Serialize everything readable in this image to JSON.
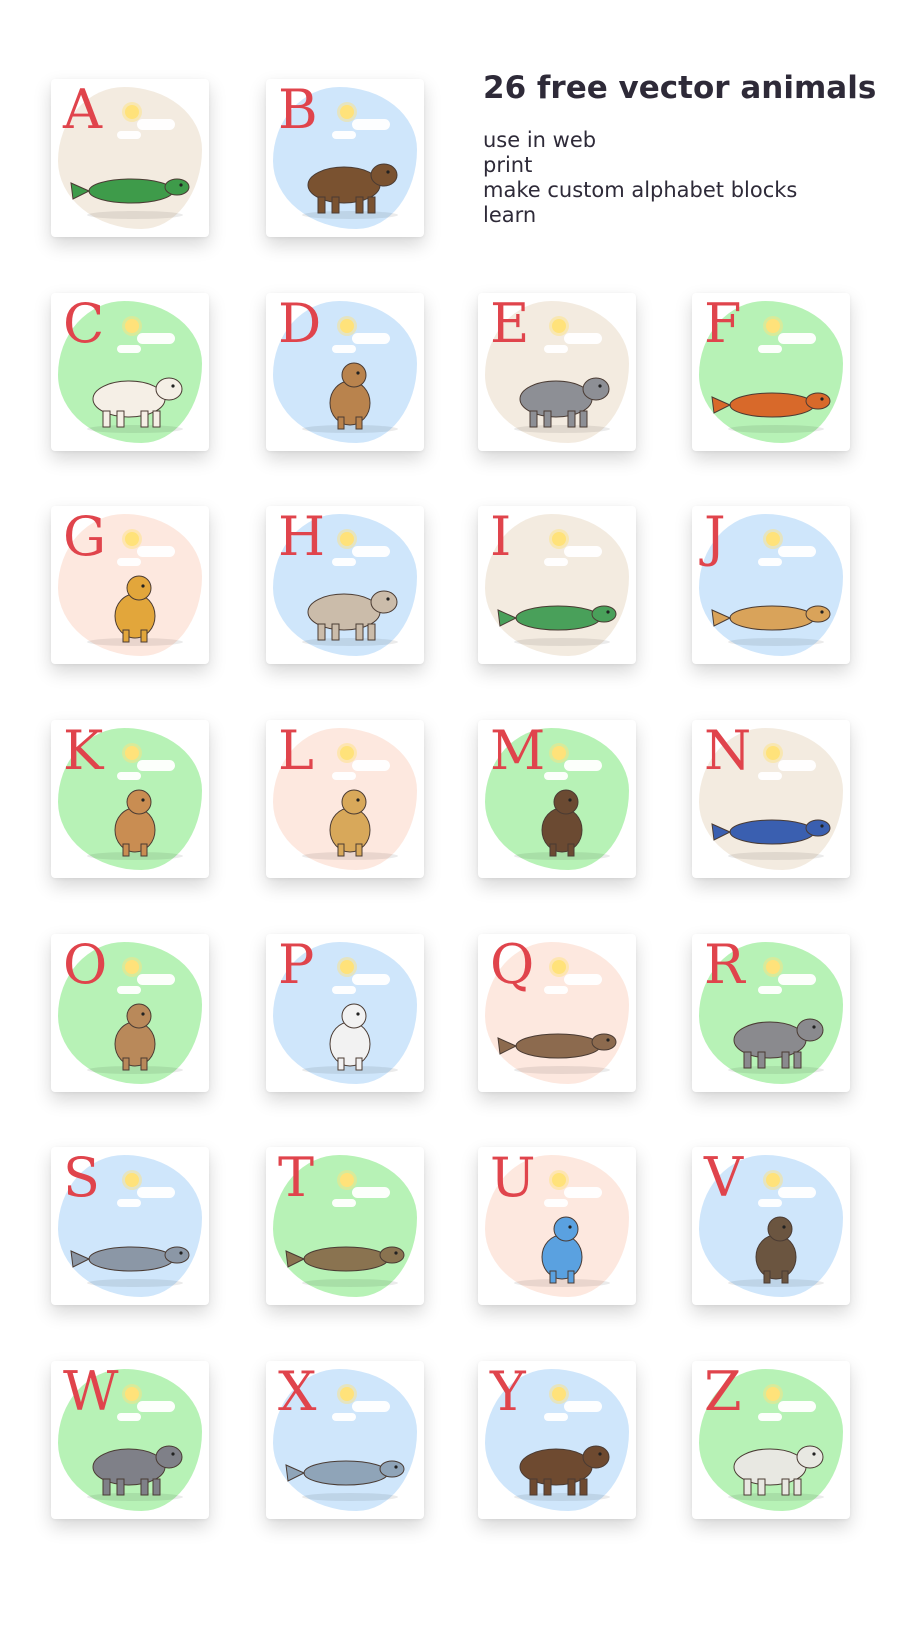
{
  "header": {
    "title": "26 free vector animals",
    "uses": [
      "use in web",
      "print",
      "make custom alphabet blocks",
      "learn"
    ]
  },
  "cards": [
    {
      "letter": "A",
      "animal": "alligator",
      "bg": "beige"
    },
    {
      "letter": "B",
      "animal": "bear",
      "bg": "blue"
    },
    {
      "letter": "C",
      "animal": "cow",
      "bg": "green"
    },
    {
      "letter": "D",
      "animal": "deer",
      "bg": "blue"
    },
    {
      "letter": "E",
      "animal": "elephant",
      "bg": "beige"
    },
    {
      "letter": "F",
      "animal": "fox",
      "bg": "green"
    },
    {
      "letter": "G",
      "animal": "giraffe",
      "bg": "pink"
    },
    {
      "letter": "H",
      "animal": "horse",
      "bg": "blue"
    },
    {
      "letter": "I",
      "animal": "iguana",
      "bg": "beige"
    },
    {
      "letter": "J",
      "animal": "jaguar",
      "bg": "blue"
    },
    {
      "letter": "K",
      "animal": "kangaroo",
      "bg": "green"
    },
    {
      "letter": "L",
      "animal": "lion",
      "bg": "pink"
    },
    {
      "letter": "M",
      "animal": "monkey",
      "bg": "green"
    },
    {
      "letter": "N",
      "animal": "narwhal",
      "bg": "beige"
    },
    {
      "letter": "O",
      "animal": "owl",
      "bg": "green"
    },
    {
      "letter": "P",
      "animal": "panda",
      "bg": "blue"
    },
    {
      "letter": "Q",
      "animal": "quail",
      "bg": "pink"
    },
    {
      "letter": "R",
      "animal": "raccoon",
      "bg": "green"
    },
    {
      "letter": "S",
      "animal": "shark",
      "bg": "blue"
    },
    {
      "letter": "T",
      "animal": "tortoise",
      "bg": "green"
    },
    {
      "letter": "U",
      "animal": "unicorn",
      "bg": "pink"
    },
    {
      "letter": "V",
      "animal": "vulture",
      "bg": "blue"
    },
    {
      "letter": "W",
      "animal": "wolf",
      "bg": "green"
    },
    {
      "letter": "X",
      "animal": "x-ray fish",
      "bg": "blue"
    },
    {
      "letter": "Y",
      "animal": "yak",
      "bg": "blue"
    },
    {
      "letter": "Z",
      "animal": "zebra",
      "bg": "green"
    }
  ],
  "colors": {
    "letter": "#e0444c",
    "title": "#2e2a38",
    "bg_beige": "#f3ebe0",
    "bg_blue": "#cfe6fb",
    "bg_green": "#b7f2b6",
    "bg_pink": "#fde8df"
  }
}
